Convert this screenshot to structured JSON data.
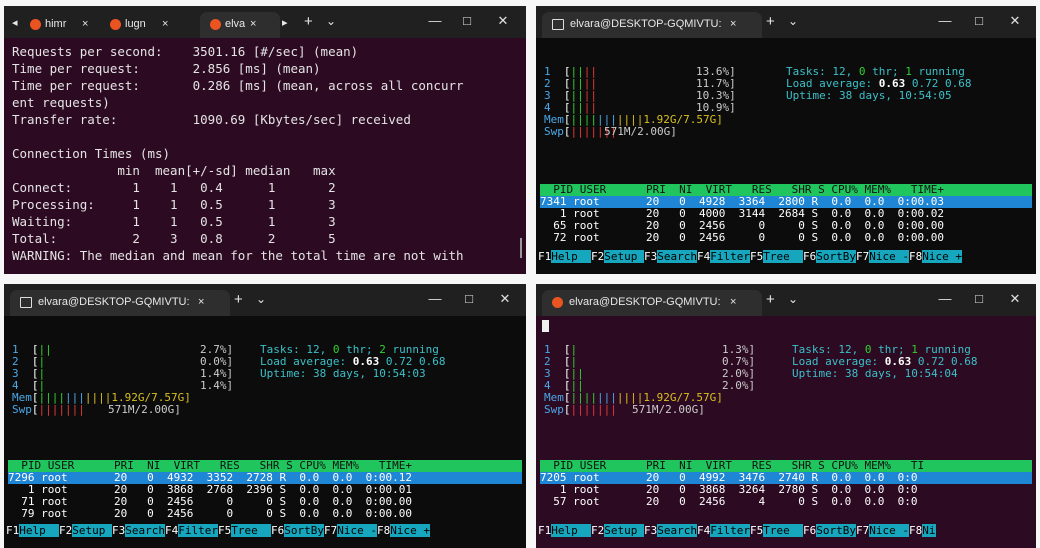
{
  "win1": {
    "tabs": [
      "himr",
      "lugn",
      "elva"
    ],
    "lines": [
      "Requests per second:    3501.16 [#/sec] (mean)",
      "Time per request:       2.856 [ms] (mean)",
      "Time per request:       0.286 [ms] (mean, across all concurr",
      "ent requests)",
      "Transfer rate:          1090.69 [Kbytes/sec] received",
      "",
      "Connection Times (ms)",
      "              min  mean[+/-sd] median   max",
      "Connect:        1    1   0.4      1       2",
      "Processing:     1    1   0.5      1       3",
      "Waiting:        1    1   0.5      1       3",
      "Total:          2    3   0.8      2       5",
      "WARNING: The median and mean for the total time are not with"
    ]
  },
  "htop_windows": [
    {
      "title": "elvara@DESKTOP-GQMIVTU:",
      "cpu": [
        {
          "num": "1",
          "pct": "13.6%]"
        },
        {
          "num": "2",
          "pct": "11.7%]"
        },
        {
          "num": "3",
          "pct": "10.3%]"
        },
        {
          "num": "4",
          "pct": "10.9%]"
        }
      ],
      "mem": "1.92G/7.57G]",
      "swp": "571M/2.00G]",
      "tasks_count": "12",
      "tasks_thr": "0",
      "tasks_running": "1",
      "load_1": "0.63",
      "load_5": "0.72",
      "load_15": "0.68",
      "uptime": "38 days, 10:54:05",
      "header": "  PID USER      PRI  NI  VIRT   RES   SHR S CPU% MEM%   TIME+",
      "rows": [
        "7341 root       20   0  4928  3364  2800 R  0.0  0.0  0:00.03",
        "   1 root       20   0  4000  3144  2684 S  0.0  0.0  0:00.02",
        "  65 root       20   0  2456     0     0 S  0.0  0.0  0:00.00",
        "  72 root       20   0  2456     0     0 S  0.0  0.0  0:00.00"
      ],
      "fkeys": [
        {
          "k": "F1",
          "l": "Help  "
        },
        {
          "k": "F2",
          "l": "Setup "
        },
        {
          "k": "F3",
          "l": "Search"
        },
        {
          "k": "F4",
          "l": "Filter"
        },
        {
          "k": "F5",
          "l": "Tree  "
        },
        {
          "k": "F6",
          "l": "SortBy"
        },
        {
          "k": "F7",
          "l": "Nice -"
        },
        {
          "k": "F8",
          "l": "Nice +"
        }
      ]
    },
    {
      "title": "elvara@DESKTOP-GQMIVTU:",
      "cpu": [
        {
          "num": "1",
          "pct": "2.7%]"
        },
        {
          "num": "2",
          "pct": "0.0%]"
        },
        {
          "num": "3",
          "pct": "1.4%]"
        },
        {
          "num": "4",
          "pct": "1.4%]"
        }
      ],
      "mem": "1.92G/7.57G]",
      "swp": "571M/2.00G]",
      "tasks_count": "12",
      "tasks_thr": "0",
      "tasks_running": "2",
      "load_1": "0.63",
      "load_5": "0.72",
      "load_15": "0.68",
      "uptime": "38 days, 10:54:03",
      "header": "  PID USER      PRI  NI  VIRT   RES   SHR S CPU% MEM%   TIME+",
      "rows": [
        "7296 root       20   0  4932  3352  2728 R  0.0  0.0  0:00.12",
        "   1 root       20   0  3868  2768  2396 S  0.0  0.0  0:00.01",
        "  71 root       20   0  2456     0     0 S  0.0  0.0  0:00.00",
        "  79 root       20   0  2456     0     0 S  0.0  0.0  0:00.00"
      ],
      "fkeys": [
        {
          "k": "F1",
          "l": "Help  "
        },
        {
          "k": "F2",
          "l": "Setup "
        },
        {
          "k": "F3",
          "l": "Search"
        },
        {
          "k": "F4",
          "l": "Filter"
        },
        {
          "k": "F5",
          "l": "Tree  "
        },
        {
          "k": "F6",
          "l": "SortBy"
        },
        {
          "k": "F7",
          "l": "Nice -"
        },
        {
          "k": "F8",
          "l": "Nice +"
        }
      ]
    },
    {
      "title": "elvara@DESKTOP-GQMIVTU:",
      "cpu": [
        {
          "num": "1",
          "pct": "1.3%]"
        },
        {
          "num": "2",
          "pct": "0.7%]"
        },
        {
          "num": "3",
          "pct": "2.0%]"
        },
        {
          "num": "4",
          "pct": "2.0%]"
        }
      ],
      "mem": "1.92G/7.57G]",
      "swp": "571M/2.00G]",
      "tasks_count": "12",
      "tasks_thr": "0",
      "tasks_running": "1",
      "load_1": "0.63",
      "load_5": "0.72",
      "load_15": "0.68",
      "uptime": "38 days, 10:54:04",
      "header": "  PID USER      PRI  NI  VIRT   RES   SHR S CPU% MEM%   TI",
      "rows": [
        "7205 root       20   0  4992  3476  2740 R  0.0  0.0  0:0",
        "   1 root       20   0  3868  3264  2780 S  0.0  0.0  0:0",
        "  57 root       20   0  2456     4     0 S  0.0  0.0  0:0"
      ],
      "fkeys": [
        {
          "k": "F1",
          "l": "Help  "
        },
        {
          "k": "F2",
          "l": "Setup "
        },
        {
          "k": "F3",
          "l": "Search"
        },
        {
          "k": "F4",
          "l": "Filter"
        },
        {
          "k": "F5",
          "l": "Tree  "
        },
        {
          "k": "F6",
          "l": "SortBy"
        },
        {
          "k": "F7",
          "l": "Nice -"
        },
        {
          "k": "F8",
          "l": "Ni"
        }
      ]
    }
  ],
  "common": {
    "new_tab_glyph": "+",
    "dropdown_glyph": "⌄",
    "close_glyph": "×",
    "minimize_glyph": "—",
    "maximize_glyph": "□",
    "close_window_glyph": "✕",
    "tasks_label": "Tasks:",
    "thr_label": "thr;",
    "running_label": "running",
    "load_label": "Load average:",
    "uptime_label": "Uptime:",
    "mem_label": "Mem",
    "swp_label": "Swp"
  }
}
